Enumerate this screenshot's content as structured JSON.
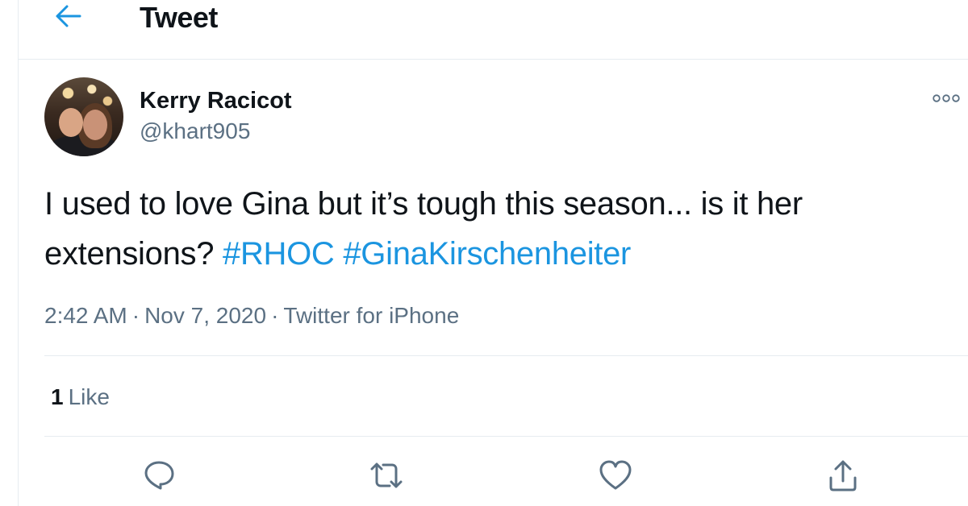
{
  "header": {
    "title": "Tweet",
    "back_icon": "arrow-left-icon"
  },
  "colors": {
    "accent": "#1b95e0",
    "secondary_text": "#5b7083",
    "primary_text": "#0f1419",
    "divider": "#e6ecf0"
  },
  "tweet": {
    "author_name": "Kerry Racicot",
    "author_handle": "@khart905",
    "text_part1": "I used to love Gina but it’s tough this season... is it her extensions? ",
    "hashtags": [
      "#RHOC",
      "#GinaKirschenheiter"
    ],
    "time": "2:42 AM",
    "date": "Nov 7, 2020",
    "source": "Twitter for iPhone",
    "separator": "·",
    "like_count": "1",
    "like_label": "Like"
  },
  "actions": [
    {
      "name": "reply",
      "icon": "reply-icon"
    },
    {
      "name": "retweet",
      "icon": "retweet-icon"
    },
    {
      "name": "like",
      "icon": "heart-icon"
    },
    {
      "name": "share",
      "icon": "share-icon"
    }
  ]
}
